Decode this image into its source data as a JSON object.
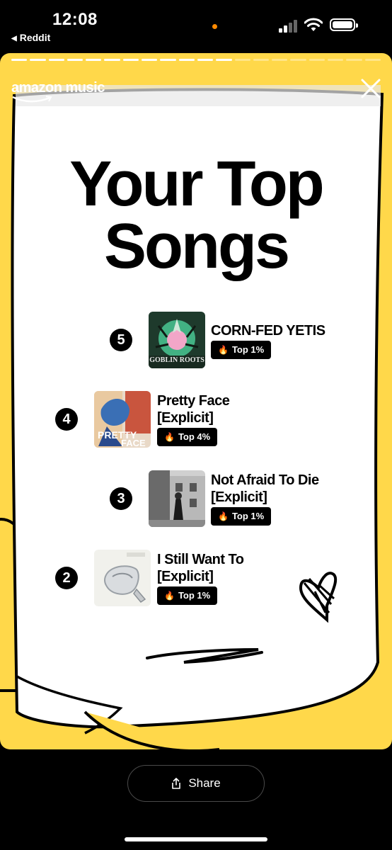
{
  "status_bar": {
    "time": "12:08",
    "back_app": "Reddit"
  },
  "story": {
    "progress_segments_total": 20,
    "progress_segments_done": 12,
    "brand": "amazon music",
    "title_line1": "Your Top",
    "title_line2": "Songs",
    "songs": [
      {
        "rank": "5",
        "title_lines": [
          "CORN-FED YETIS"
        ],
        "badge": "Top 1%",
        "art_text": "GOBLIN ROOTS"
      },
      {
        "rank": "4",
        "title_lines": [
          "Pretty Face",
          "[Explicit]"
        ],
        "badge": "Top 4%",
        "art_text_1": "PRETTY",
        "art_text_2": "FACE"
      },
      {
        "rank": "3",
        "title_lines": [
          "Not Afraid To Die",
          "[Explicit]"
        ],
        "badge": "Top 1%"
      },
      {
        "rank": "2",
        "title_lines": [
          "I Still Want To",
          "[Explicit]"
        ],
        "badge": "Top 1%"
      }
    ]
  },
  "bottom": {
    "share_label": "Share"
  },
  "colors": {
    "background": "#000000",
    "accent_yellow": "#ffd84a",
    "paper": "#ffffff"
  }
}
